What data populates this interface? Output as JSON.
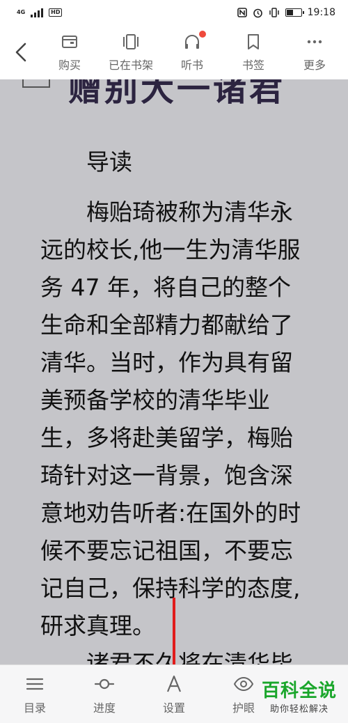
{
  "status_bar": {
    "network": "4G",
    "sim": "HD",
    "time": "19:18"
  },
  "toolbar": {
    "back_icon": "chevron-left-icon",
    "items": [
      {
        "label": "购买",
        "icon": "wallet-icon"
      },
      {
        "label": "已在书架",
        "icon": "bookshelf-icon"
      },
      {
        "label": "听书",
        "icon": "headphones-icon",
        "badge_color": "#ef4a3c"
      },
      {
        "label": "书签",
        "icon": "bookmark-icon"
      },
      {
        "label": "更多",
        "icon": "more-icon"
      }
    ]
  },
  "reader": {
    "chapter_title": "赠别大一诸君",
    "paragraphs": [
      "导读",
      "梅贻琦被称为清华永远的校长,他一生为清华服务 47 年，将自己的整个生命和全部精力都献给了清华。当时，作为具有留美预备学校的清华毕业生，多将赴美留学，梅贻琦针对这一背景，饱含深意地劝告听者:在国外的时候不要忘记祖国，不要忘记自己，保持科学的态度,研求真理。",
      "诸君不久将在清华毕"
    ],
    "background_color": "#c5c5c9"
  },
  "bottom_bar": {
    "items": [
      {
        "label": "目录",
        "icon": "menu-icon"
      },
      {
        "label": "进度",
        "icon": "progress-icon"
      },
      {
        "label": "设置",
        "icon": "font-settings-icon"
      },
      {
        "label": "护眼",
        "icon": "eye-icon"
      }
    ]
  },
  "annotation": {
    "arrow_color": "#e11b1b"
  },
  "watermark": {
    "title": "百科全说",
    "subtitle": "助你轻松解决",
    "color": "#1aa62b"
  }
}
